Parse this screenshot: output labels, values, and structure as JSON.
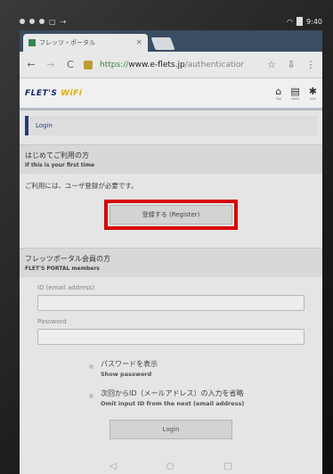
{
  "status": {
    "time": "9:40"
  },
  "browser": {
    "tab_title": "フレッツ・ポータル",
    "tab_close": "×",
    "url_scheme": "https://",
    "url_host": "www.e-flets.jp",
    "url_path": "/authenticatior"
  },
  "site": {
    "brand_flets": "FLET'S",
    "brand_wifi": "WiFi",
    "nav": [
      {
        "icon": "home-icon",
        "label": "Top"
      },
      {
        "icon": "mail-icon",
        "label": "Inbox"
      },
      {
        "icon": "gear-icon",
        "label": "Info"
      }
    ]
  },
  "login_bar": {
    "label": "Login"
  },
  "first_time": {
    "title_jp": "はじめてご利用の方",
    "title_en": "If this is your first time",
    "note": "ご利用には、ユーザ登録が必要です。",
    "register_label": "登録する (Register)"
  },
  "members": {
    "title_jp": "フレッツポータル会員の方",
    "title_en": "FLET'S PORTAL members",
    "id_label": "ID (email address)",
    "password_label": "Password"
  },
  "options": {
    "show_password_jp": "パスワードを表示",
    "show_password_en": "Show password",
    "omit_id_jp": "次回からID（メールアドレス）の入力を省略",
    "omit_id_en": "Omit input ID from the next (email address)"
  },
  "login_button": {
    "label": "Login"
  },
  "colors": {
    "highlight": "#e00000",
    "brand": "#1b2a6b",
    "accent": "#f0b400"
  }
}
